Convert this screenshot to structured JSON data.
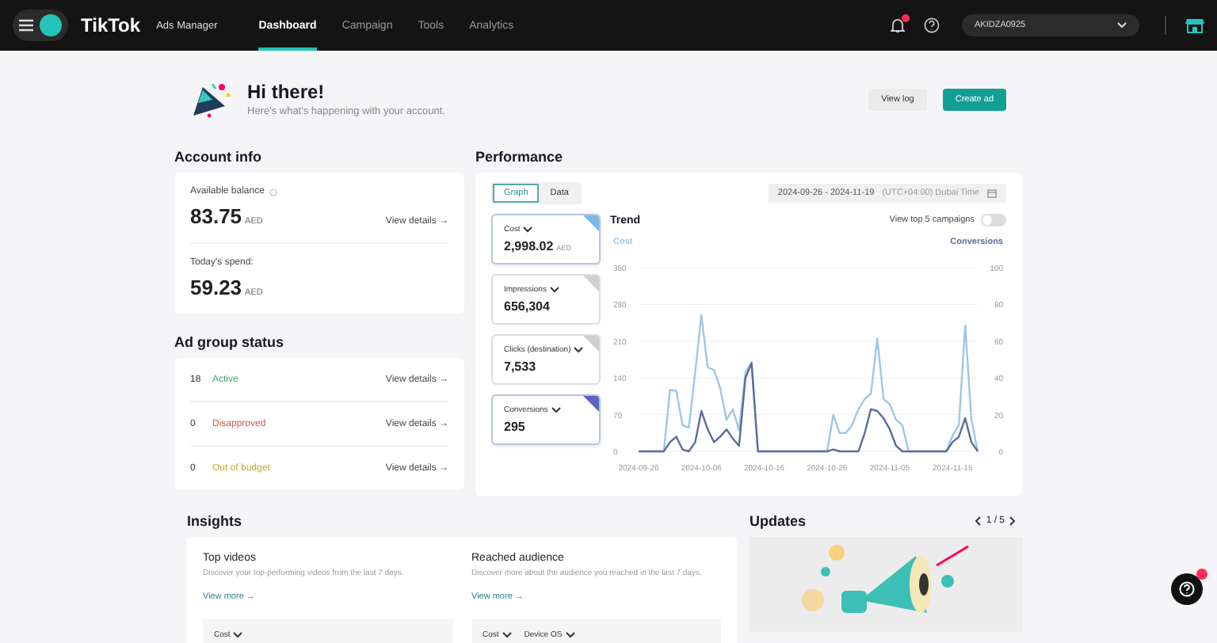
{
  "topbar": {
    "brand": "TikTok",
    "product": "Ads Manager",
    "nav": [
      {
        "label": "Dashboard",
        "selected": true
      },
      {
        "label": "Campaign",
        "selected": false
      },
      {
        "label": "Tools",
        "selected": false
      },
      {
        "label": "Analytics",
        "selected": false
      }
    ],
    "notifications_unread": true,
    "account": "AKIDZA0925"
  },
  "greeting": {
    "title": "Hi there!",
    "subtitle": "Here's what's happening with your account.",
    "buttons": [
      {
        "label": "View log",
        "kind": "secondary"
      },
      {
        "label": "Create ad",
        "kind": "primary"
      }
    ]
  },
  "account_info": {
    "title": "Account info",
    "items": [
      {
        "label": "Available balance",
        "info": true,
        "amount": "83.75",
        "currency": "AED",
        "link": "View details →"
      },
      {
        "label": "Today's spend:",
        "info": false,
        "amount": "59.23",
        "currency": "AED"
      }
    ]
  },
  "ad_group_status": {
    "title": "Ad group status",
    "rows": [
      {
        "count": "18",
        "status": "Active",
        "color": "#3aa76d",
        "link": "View details →"
      },
      {
        "count": "0",
        "status": "Disapproved",
        "color": "#d9534f",
        "link": "View details →"
      },
      {
        "count": "0",
        "status": "Out of budget",
        "color": "#c9a227",
        "link": "View details →"
      }
    ]
  },
  "performance": {
    "title": "Performance",
    "views": [
      {
        "label": "Graph",
        "selected": true
      },
      {
        "label": "Data",
        "selected": false
      }
    ],
    "date_range": {
      "start": "2024-09-26",
      "separator": "-",
      "end": "2024-11-19",
      "timezone": "(UTC+04:00) Dubai Time"
    },
    "metrics": [
      {
        "name": "Cost",
        "value": "2,998.02",
        "unit": "AED",
        "selected": true,
        "color": "#7ab8e8"
      },
      {
        "name": "Impressions",
        "value": "656,304",
        "selected": false,
        "color": "#cfcfcf"
      },
      {
        "name": "Clicks (destination)",
        "value": "7,533",
        "selected": false,
        "color": "#cfcfcf"
      },
      {
        "name": "Conversions",
        "value": "295",
        "selected": true,
        "color": "#5a66c4"
      }
    ],
    "trend": {
      "title": "Trend",
      "toggle_label": "View top 5 campaigns",
      "toggle_on": false,
      "chart_data": {
        "type": "line",
        "categories": [
          "2024-09-26",
          null,
          null,
          null,
          null,
          null,
          null,
          null,
          null,
          null,
          "2024-10-06",
          null,
          null,
          null,
          null,
          null,
          null,
          null,
          null,
          null,
          "2024-10-16",
          null,
          null,
          null,
          null,
          null,
          null,
          null,
          null,
          null,
          "2024-10-26",
          null,
          null,
          null,
          null,
          null,
          null,
          null,
          null,
          null,
          "2024-11-05",
          null,
          null,
          null,
          null,
          null,
          null,
          null,
          null,
          null,
          "2024-11-15",
          null,
          null,
          null,
          null
        ],
        "ylim": [
          0,
          350
        ],
        "y2lim": [
          0,
          100
        ],
        "grid": true,
        "yticks": [
          0,
          70,
          140,
          210,
          280,
          350
        ],
        "y2ticks": [
          0,
          20,
          40,
          60,
          80,
          100
        ],
        "series": [
          {
            "name": "Cost",
            "color": "#9cc7ea",
            "axis": "y",
            "values": [
              0,
              0,
              0,
              0,
              0,
              117,
              115,
              50,
              45,
              150,
              260,
              160,
              155,
              120,
              60,
              80,
              40,
              150,
              170,
              0,
              0,
              0,
              0,
              0,
              0,
              0,
              0,
              0,
              0,
              0,
              0,
              70,
              35,
              35,
              50,
              80,
              100,
              110,
              215,
              100,
              90,
              60,
              50,
              0,
              0,
              0,
              0,
              0,
              0,
              0,
              30,
              50,
              240,
              60,
              0
            ]
          },
          {
            "name": "Conversions",
            "color": "#5b6d9c",
            "axis": "y2",
            "values": [
              0,
              0,
              0,
              0,
              0,
              5,
              8,
              1,
              0,
              5,
              22,
              12,
              5,
              8,
              12,
              7,
              3,
              40,
              48,
              0,
              0,
              0,
              0,
              0,
              0,
              0,
              0,
              0,
              0,
              0,
              0,
              1,
              0,
              0,
              0,
              0,
              10,
              23,
              22,
              18,
              12,
              3,
              0,
              0,
              0,
              0,
              0,
              0,
              0,
              0,
              5,
              8,
              18,
              5,
              0
            ]
          }
        ]
      }
    }
  },
  "insights": {
    "title": "Insights",
    "cards": [
      {
        "title": "Top videos",
        "description": "Discover your top-performing videos from the last 7 days.",
        "link": "View more →",
        "filters": [
          "Cost"
        ]
      },
      {
        "title": "Reached audience",
        "description": "Discover more about the audience you reached in the last 7 days.",
        "link": "View more →",
        "filters": [
          "Cost",
          "Device OS"
        ]
      }
    ]
  },
  "updates": {
    "title": "Updates",
    "pager": "1 / 5"
  },
  "help": {
    "unread": true
  }
}
